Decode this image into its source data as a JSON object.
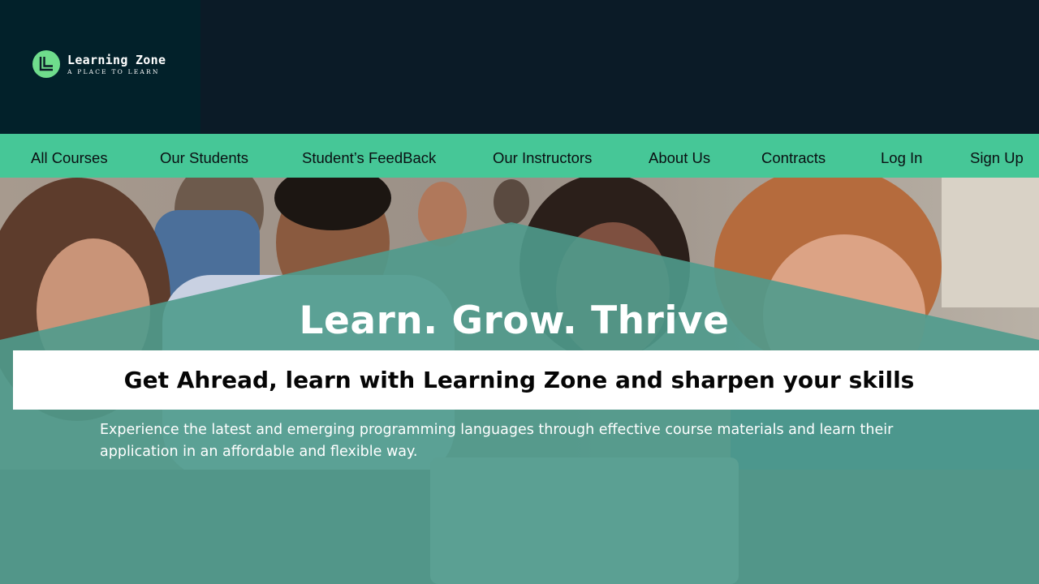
{
  "brand": {
    "name": "Learning Zone",
    "tagline": "A PLACE TO LEARN",
    "logo_icon": "learning-zone-logo-icon",
    "accent_color": "#46c797",
    "dark_color": "#0b1b27"
  },
  "nav": {
    "items": [
      {
        "label": "All Courses"
      },
      {
        "label": "Our Students"
      },
      {
        "label": "Student’s FeedBack"
      },
      {
        "label": "Our Instructors"
      },
      {
        "label": "About Us"
      },
      {
        "label": "Contracts"
      },
      {
        "label": "Log In"
      },
      {
        "label": "Sign Up"
      }
    ]
  },
  "hero": {
    "title": "Learn. Grow. Thrive",
    "subheading": "Get Ahread, learn with Learning Zone and sharpen your skills",
    "description": "Experience the latest and emerging programming languages through effective course materials and learn their application in an affordable and flexible way.",
    "overlay_color": "#4f9b8d"
  }
}
